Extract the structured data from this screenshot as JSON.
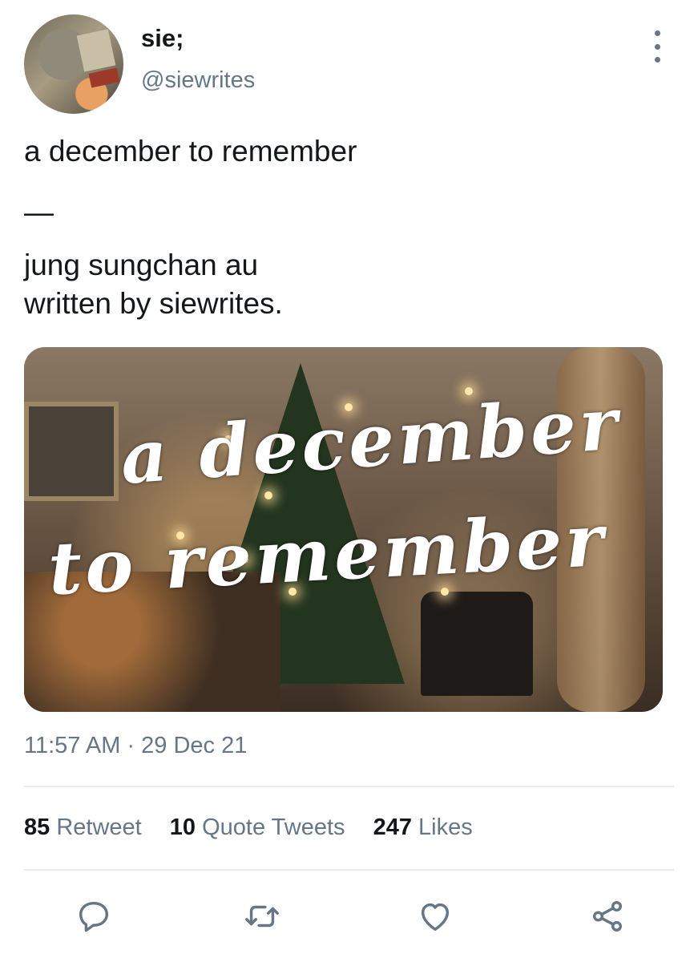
{
  "user": {
    "display_name": "sie;",
    "handle": "@siewrites"
  },
  "tweet": {
    "lines": [
      "a december to remember",
      "—",
      "jung sungchan au",
      "written by siewrites."
    ],
    "image_overlay": {
      "line1": "a december",
      "line2": "to remember"
    },
    "timestamp": "11:57 AM · 29 Dec 21"
  },
  "stats": [
    {
      "count": "85",
      "label": "Retweet"
    },
    {
      "count": "10",
      "label": "Quote Tweets"
    },
    {
      "count": "247",
      "label": "Likes"
    }
  ],
  "actions": {
    "reply_icon": "reply-icon",
    "retweet_icon": "retweet-icon",
    "like_icon": "heart-icon",
    "share_icon": "share-icon"
  },
  "colors": {
    "text": "#14171a",
    "secondary": "#657786",
    "divider": "#e6ecf0"
  }
}
